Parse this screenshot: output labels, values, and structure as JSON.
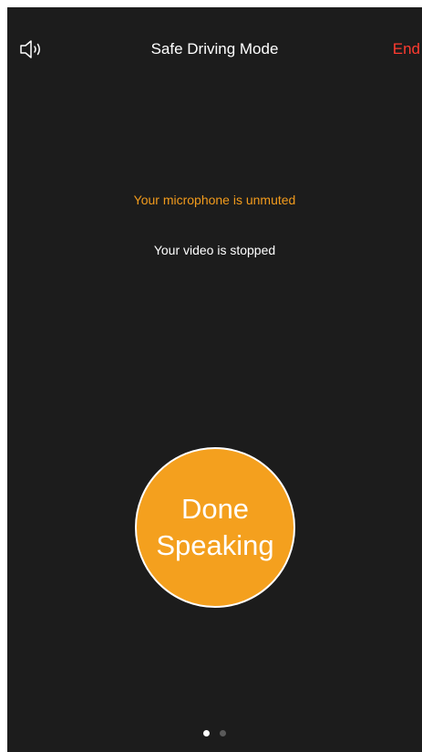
{
  "header": {
    "title": "Safe Driving Mode",
    "end_label": "End",
    "speaker_icon": "speaker-icon"
  },
  "status": {
    "microphone": "Your microphone is unmuted",
    "video": "Your video is stopped"
  },
  "done_button": {
    "line1": "Done",
    "line2": "Speaking"
  },
  "pager": {
    "page_count": 2,
    "active_index": 0
  },
  "colors": {
    "background": "#1c1c1c",
    "accent_orange": "#f4a01e",
    "mic_status_text": "#f29b1c",
    "end_red": "#ff3b30",
    "dot_active": "#ffffff",
    "dot_inactive": "#5a5a5a"
  }
}
